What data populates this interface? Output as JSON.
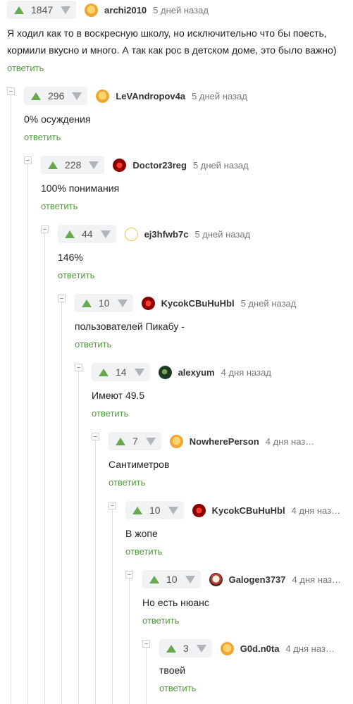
{
  "comments": [
    {
      "score": "1847",
      "user": "archi2010",
      "date": "5 дней назад",
      "text_lines": [
        "Я ходил как то в воскресную школу, но исключительно что бы поесть,",
        "кормили вкусно и много. А так как рос в детском доме, это было важно)"
      ],
      "reply": "ответить",
      "avatar": "avatar-smiley-yellow"
    },
    {
      "score": "296",
      "user": "LeVAndropov4a",
      "date": "5 дней назад",
      "text_lines": [
        "0% осуждения"
      ],
      "reply": "ответить",
      "avatar": "avatar-smiley-yellow"
    },
    {
      "score": "228",
      "user": "Doctor23reg",
      "date": "5 дней назад",
      "text_lines": [
        "100% понимания"
      ],
      "reply": "ответить",
      "avatar": "avatar-red-dark"
    },
    {
      "score": "44",
      "user": "ej3hfwb7c",
      "date": "5 дней назад",
      "text_lines": [
        "146%"
      ],
      "reply": "ответить",
      "avatar": "avatar-empty-circle"
    },
    {
      "score": "10",
      "user": "KycokCBuHuHbl",
      "date": "5 дней назад",
      "text_lines": [
        "пользователей Пикабу -"
      ],
      "reply": "ответить",
      "avatar": "avatar-red-dark"
    },
    {
      "score": "14",
      "user": "alexyum",
      "date": "4 дня назад",
      "text_lines": [
        "Имеют 49.5"
      ],
      "reply": "ответить",
      "avatar": "avatar-dark-green"
    },
    {
      "score": "7",
      "user": "NowherePerson",
      "date": "4 дня наз…",
      "text_lines": [
        "Сантиметров"
      ],
      "reply": "ответить",
      "avatar": "avatar-smiley-yellow"
    },
    {
      "score": "10",
      "user": "KycokCBuHuHbl",
      "date": "4 дня наз…",
      "text_lines": [
        "В жопе"
      ],
      "reply": "ответить",
      "avatar": "avatar-red-dark"
    },
    {
      "score": "10",
      "user": "Galogen3737",
      "date": "4 дня наз…",
      "text_lines": [
        "Но есть нюанс"
      ],
      "reply": "ответить",
      "avatar": "avatar-mask"
    },
    {
      "score": "3",
      "user": "G0d.n0ta",
      "date": "4 дня наз…",
      "text_lines": [
        "твоей"
      ],
      "reply": "ответить",
      "avatar": "avatar-smiley-yellow"
    }
  ],
  "colors": {
    "upvote": "#6aa84f",
    "downvote": "#b1b5bb",
    "reply_link": "#4f9d3c",
    "rating_bg": "#f1f2f4",
    "thread_line": "#dcdcdc"
  },
  "icons": {
    "upvote": "upvote-arrow-icon",
    "downvote": "downvote-arrow-icon",
    "collapse": "collapse-minus-icon"
  }
}
